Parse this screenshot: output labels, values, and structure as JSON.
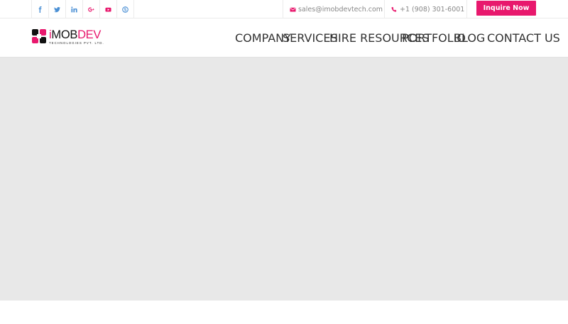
{
  "topbar": {
    "social": [
      {
        "icon": "facebook-icon",
        "label": "f"
      },
      {
        "icon": "twitter-icon",
        "label": "t"
      },
      {
        "icon": "linkedin-icon",
        "label": "in"
      },
      {
        "icon": "google-plus-icon",
        "label": "g+"
      },
      {
        "icon": "youtube-icon",
        "label": "yt"
      },
      {
        "icon": "skype-icon",
        "label": "s"
      }
    ],
    "email": "sales@imobdevtech.com",
    "phone": "+1 (908) 301-6001",
    "inquire_label": "Inquire Now"
  },
  "header": {
    "logo": {
      "prefix": "i",
      "main": "MOB",
      "suffix": "DEV",
      "tagline": "TECHNOLOGIES PVT. LTD."
    },
    "nav": [
      "COMPANY",
      "SERVICES",
      "HIRE RESOURCES",
      "PORTFOLIO",
      "BLOG",
      "CONTACT US"
    ]
  },
  "colors": {
    "accent": "#e8186d",
    "social_icon": "#4a8fd4",
    "hero_bg": "#e8e8e8"
  }
}
